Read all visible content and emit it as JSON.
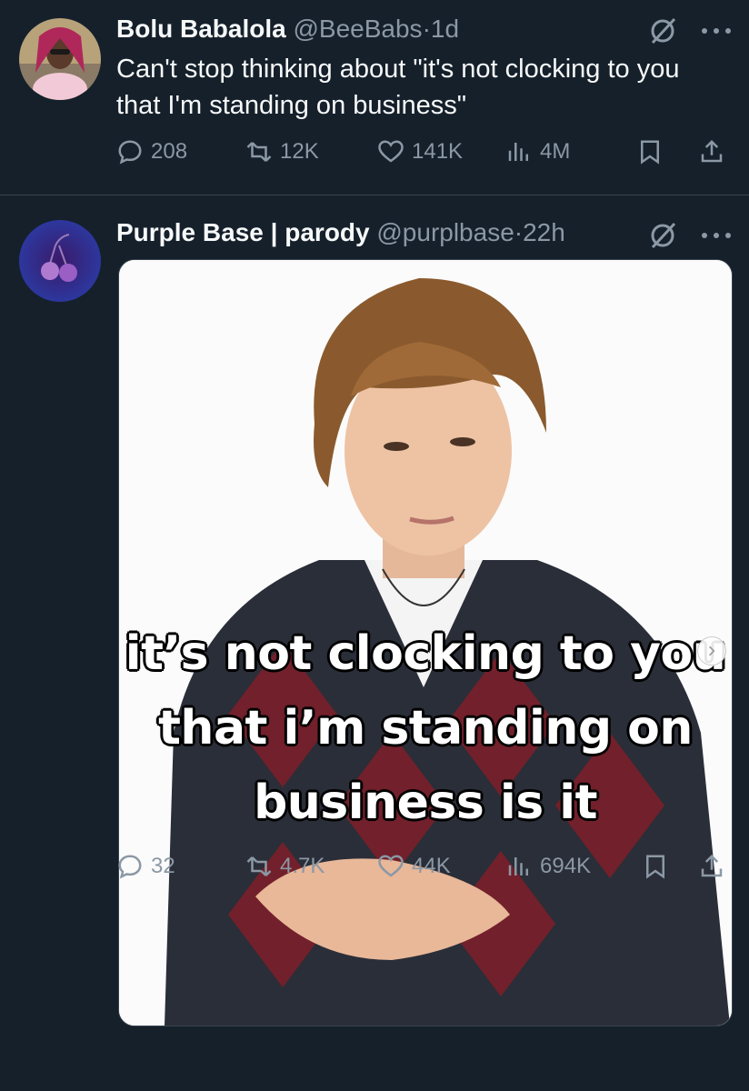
{
  "tweets": [
    {
      "author_name": "Bolu Babalola",
      "handle": "@BeeBabs",
      "separator": "·",
      "time": "1d",
      "text": "Can't stop thinking about \"it's not clocking to you that I'm standing on business\"",
      "replies": "208",
      "retweets": "12K",
      "likes": "141K",
      "views": "4M"
    },
    {
      "author_name": "Purple Base | parody",
      "handle": "@purplbase",
      "separator": "·",
      "time": "22h",
      "media_caption": "it’s not clocking to you that i’m standing on business is it",
      "replies": "32",
      "retweets": "4.7K",
      "likes": "44K",
      "views": "694K"
    }
  ],
  "colors": {
    "background": "#15202b",
    "text_primary": "#f7f9f9",
    "text_secondary": "#8b98a5",
    "divider": "#38444d"
  },
  "icons": [
    "grok-icon",
    "more-icon",
    "reply-icon",
    "retweet-icon",
    "like-icon",
    "views-icon",
    "bookmark-icon",
    "share-icon",
    "chevron-right-icon"
  ]
}
